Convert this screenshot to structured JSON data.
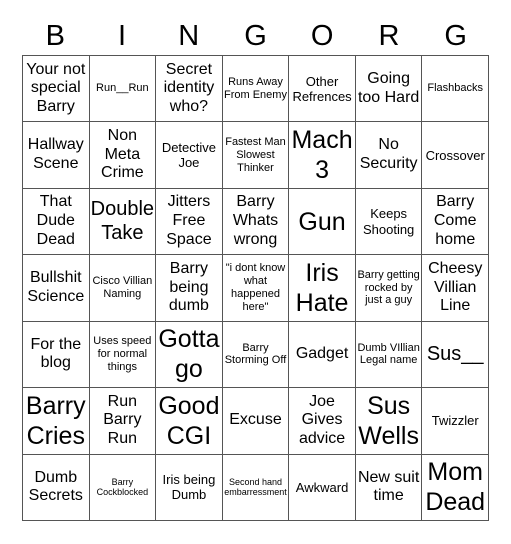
{
  "header": [
    "B",
    "I",
    "N",
    "G",
    "O",
    "R",
    "G"
  ],
  "cells": [
    {
      "text": "Your not special Barry",
      "size": "l"
    },
    {
      "text": "Run__Run",
      "size": "s"
    },
    {
      "text": "Secret identity who?",
      "size": "l"
    },
    {
      "text": "Runs Away From Enemy",
      "size": "s"
    },
    {
      "text": "Other Refrences",
      "size": "m"
    },
    {
      "text": "Going too Hard",
      "size": "l"
    },
    {
      "text": "Flashbacks",
      "size": "s"
    },
    {
      "text": "Hallway Scene",
      "size": "l"
    },
    {
      "text": "Non Meta Crime",
      "size": "l"
    },
    {
      "text": "Detective Joe",
      "size": "m"
    },
    {
      "text": "Fastest Man Slowest Thinker",
      "size": "s"
    },
    {
      "text": "Mach 3",
      "size": "xxl"
    },
    {
      "text": "No Security",
      "size": "l"
    },
    {
      "text": "Crossover",
      "size": "m"
    },
    {
      "text": "That Dude Dead",
      "size": "l"
    },
    {
      "text": "Double Take",
      "size": "xl"
    },
    {
      "text": "Jitters Free Space",
      "size": "l"
    },
    {
      "text": "Barry Whats wrong",
      "size": "l"
    },
    {
      "text": "Gun",
      "size": "xxl"
    },
    {
      "text": "Keeps Shooting",
      "size": "m"
    },
    {
      "text": "Barry Come home",
      "size": "l"
    },
    {
      "text": "Bullshit Science",
      "size": "l"
    },
    {
      "text": "Cisco Villian Naming",
      "size": "s"
    },
    {
      "text": "Barry being dumb",
      "size": "l"
    },
    {
      "text": "\"i dont know what happened here\"",
      "size": "s"
    },
    {
      "text": "Iris Hate",
      "size": "xxl"
    },
    {
      "text": "Barry getting rocked by just a guy",
      "size": "s"
    },
    {
      "text": "Cheesy Villian Line",
      "size": "l"
    },
    {
      "text": "For the blog",
      "size": "l"
    },
    {
      "text": "Uses speed for normal things",
      "size": "s"
    },
    {
      "text": "Gotta go",
      "size": "xxl"
    },
    {
      "text": "Barry Storming Off",
      "size": "s"
    },
    {
      "text": "Gadget",
      "size": "l"
    },
    {
      "text": "Dumb VIllian Legal name",
      "size": "s"
    },
    {
      "text": "Sus__",
      "size": "xl"
    },
    {
      "text": "Barry Cries",
      "size": "xxl"
    },
    {
      "text": "Run Barry Run",
      "size": "l"
    },
    {
      "text": "Good CGI",
      "size": "xxl"
    },
    {
      "text": "Excuse",
      "size": "l"
    },
    {
      "text": "Joe Gives advice",
      "size": "l"
    },
    {
      "text": "Sus Wells",
      "size": "xxl"
    },
    {
      "text": "Twizzler",
      "size": "m"
    },
    {
      "text": "Dumb Secrets",
      "size": "l"
    },
    {
      "text": "Barry Cockblocked",
      "size": "xs"
    },
    {
      "text": "Iris being Dumb",
      "size": "m"
    },
    {
      "text": "Second hand embarressment",
      "size": "xs"
    },
    {
      "text": "Awkward",
      "size": "m"
    },
    {
      "text": "New suit time",
      "size": "l"
    },
    {
      "text": "Mom Dead",
      "size": "xxl"
    }
  ]
}
